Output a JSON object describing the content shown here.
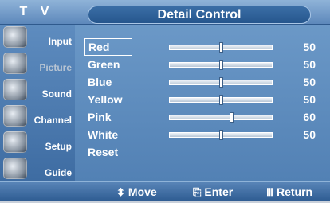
{
  "header": {
    "tv_label": "T V",
    "title": "Detail Control"
  },
  "sidebar": {
    "items": [
      {
        "label": "Input",
        "icon": "input-icon"
      },
      {
        "label": "Picture",
        "icon": "picture-icon"
      },
      {
        "label": "Sound",
        "icon": "sound-icon"
      },
      {
        "label": "Channel",
        "icon": "channel-icon"
      },
      {
        "label": "Setup",
        "icon": "setup-icon"
      },
      {
        "label": "Guide",
        "icon": "guide-icon"
      }
    ]
  },
  "controls": [
    {
      "name": "Red",
      "value": 50,
      "level": 0.5
    },
    {
      "name": "Green",
      "value": 50,
      "level": 0.5
    },
    {
      "name": "Blue",
      "value": 50,
      "level": 0.5
    },
    {
      "name": "Yellow",
      "value": 50,
      "level": 0.5
    },
    {
      "name": "Pink",
      "value": 60,
      "level": 0.6
    },
    {
      "name": "White",
      "value": 50,
      "level": 0.5
    }
  ],
  "reset_label": "Reset",
  "footer": {
    "move": "Move",
    "enter": "Enter",
    "return": "Return",
    "move_glyph": "⬍",
    "enter_glyph": "⎘",
    "return_glyph": "Ⅲ"
  },
  "colors": {
    "panel": "#4f7eb2",
    "title_pill": "#26568d"
  }
}
